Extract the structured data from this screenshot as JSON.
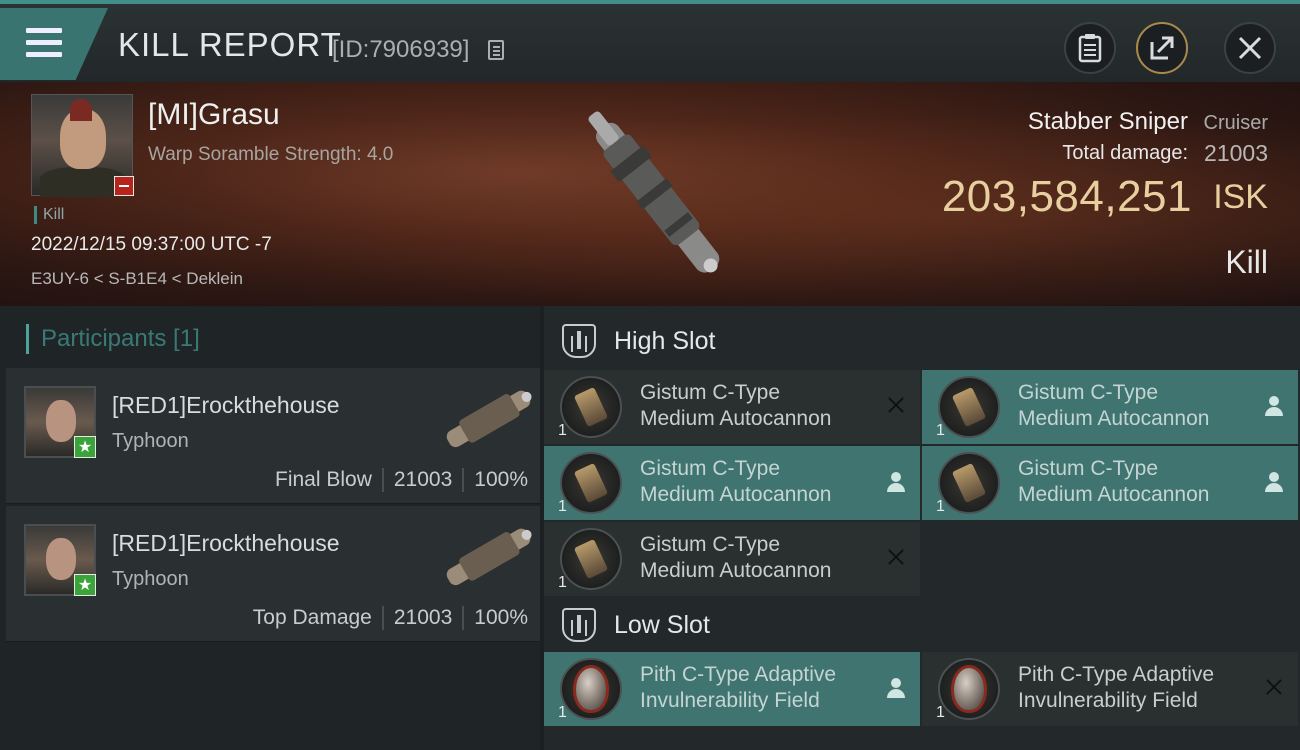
{
  "header": {
    "title": "KILL REPORT",
    "report_id": "[ID:7906939]"
  },
  "victim": {
    "name": "[MI]Grasu",
    "scramble": "Warp Soramble Strength: 4.0",
    "tag": "Kill",
    "datetime": "2022/12/15 09:37:00 UTC -7",
    "location": "E3UY-6 < S-B1E4 < Deklein",
    "ship_name": "Stabber Sniper",
    "ship_class": "Cruiser",
    "total_damage_label": "Total damage:",
    "total_damage": "21003",
    "isk_value": "203,584,251",
    "isk_unit": "ISK",
    "result": "Kill"
  },
  "participants": {
    "header": "Participants [1]",
    "rows": [
      {
        "name": "[RED1]Erockthehouse",
        "ship": "Typhoon",
        "role": "Final Blow",
        "damage": "21003",
        "percent": "100%"
      },
      {
        "name": "[RED1]Erockthehouse",
        "ship": "Typhoon",
        "role": "Top Damage",
        "damage": "21003",
        "percent": "100%"
      }
    ]
  },
  "slots": {
    "high_label": "High Slot",
    "low_label": "Low Slot",
    "high_items": [
      {
        "line1": "Gistum C-Type",
        "line2": "Medium Autocannon",
        "qty": "1",
        "status": "destroyed"
      },
      {
        "line1": "Gistum C-Type",
        "line2": "Medium Autocannon",
        "qty": "1",
        "status": "dropped"
      },
      {
        "line1": "Gistum C-Type",
        "line2": "Medium Autocannon",
        "qty": "1",
        "status": "dropped"
      },
      {
        "line1": "Gistum C-Type",
        "line2": "Medium Autocannon",
        "qty": "1",
        "status": "dropped"
      },
      {
        "line1": "Gistum C-Type",
        "line2": "Medium Autocannon",
        "qty": "1",
        "status": "destroyed"
      }
    ],
    "low_items": [
      {
        "line1": "Pith C-Type Adaptive",
        "line2": "Invulnerability Field",
        "qty": "1",
        "status": "dropped"
      },
      {
        "line1": "Pith C-Type Adaptive",
        "line2": "Invulnerability Field",
        "qty": "1",
        "status": "destroyed"
      }
    ]
  },
  "colors": {
    "accent": "#3f7470",
    "isk": "#e8cfa0",
    "badge_red": "#b8231b",
    "badge_green": "#3aa33a"
  }
}
